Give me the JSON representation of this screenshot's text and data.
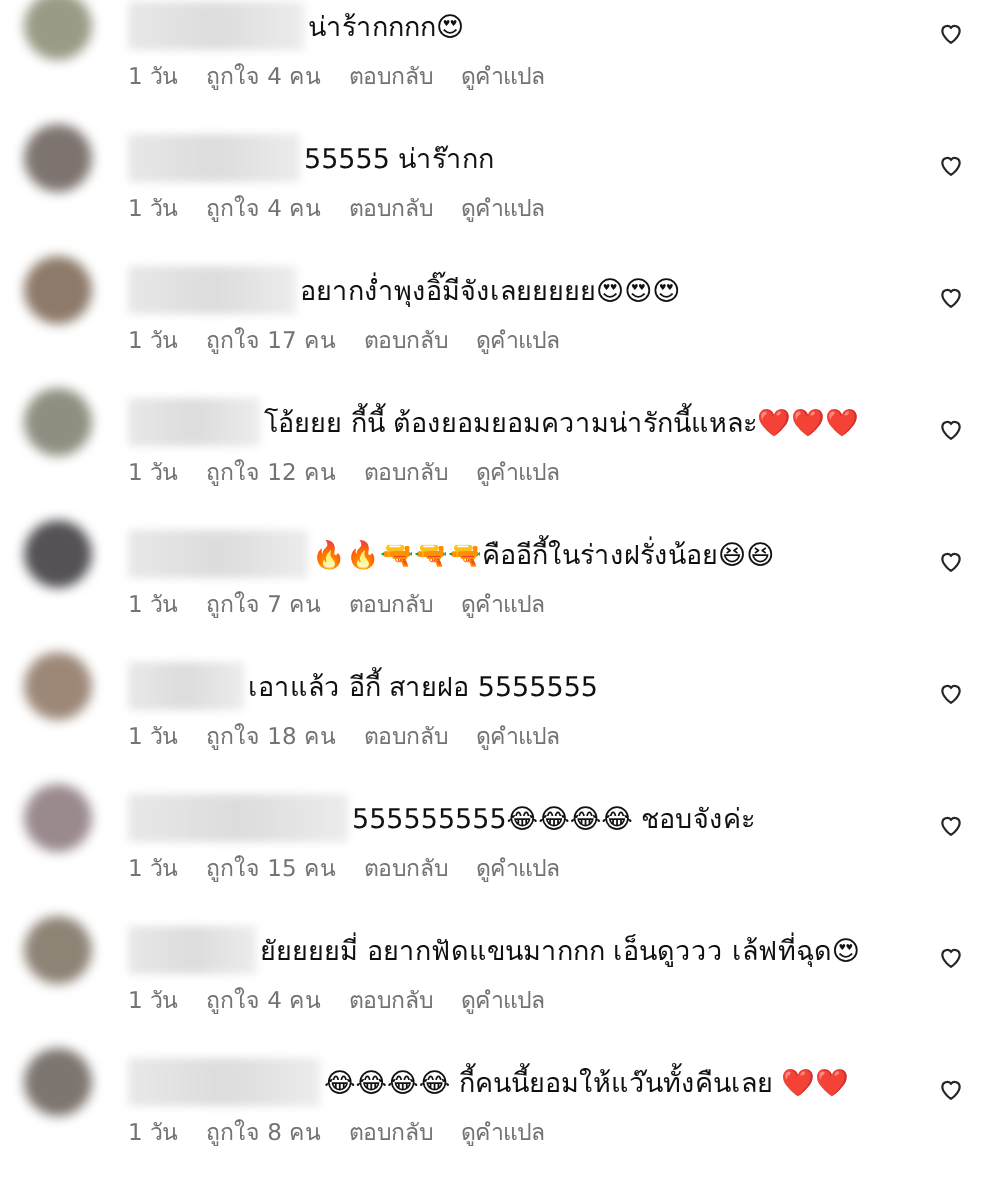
{
  "comments": [
    {
      "text": "น่าร้ากกกก😍",
      "time": "1 วัน",
      "likes": "ถูกใจ 4 คน",
      "reply": "ตอบกลับ",
      "translate": "ดูคำแปล",
      "liked": false
    },
    {
      "text": "55555 น่าร๊ากก",
      "time": "1 วัน",
      "likes": "ถูกใจ 4 คน",
      "reply": "ตอบกลับ",
      "translate": "ดูคำแปล",
      "liked": false
    },
    {
      "text": "อยากง่ำพุงอิ๊มีจังเลยยยยย😍😍😍",
      "time": "1 วัน",
      "likes": "ถูกใจ 17 คน",
      "reply": "ตอบกลับ",
      "translate": "ดูคำแปล",
      "liked": false
    },
    {
      "text": "โอ้ยยย กี้นี้ ต้องยอมยอมความน่ารักนี้แหละ❤️❤️❤️",
      "time": "1 วัน",
      "likes": "ถูกใจ 12 คน",
      "reply": "ตอบกลับ",
      "translate": "ดูคำแปล",
      "liked": false
    },
    {
      "text": "🔥🔥🔫🔫🔫คืออีกี้ในร่างฝรั่งน้อย😆😆",
      "time": "1 วัน",
      "likes": "ถูกใจ 7 คน",
      "reply": "ตอบกลับ",
      "translate": "ดูคำแปล",
      "liked": false
    },
    {
      "text": "เอาแล้ว อีกี้ สายฝอ 5555555",
      "time": "1 วัน",
      "likes": "ถูกใจ 18 คน",
      "reply": "ตอบกลับ",
      "translate": "ดูคำแปล",
      "liked": false
    },
    {
      "text": "555555555😂😂😂😂 ชอบจังค่ะ",
      "time": "1 วัน",
      "likes": "ถูกใจ 15 คน",
      "reply": "ตอบกลับ",
      "translate": "ดูคำแปล",
      "liked": false
    },
    {
      "text": "ยัยยยยมี่ อยากฟัดแขนมากกก เอ็นดูววว เล้ฟที่ฉุด😍",
      "time": "1 วัน",
      "likes": "ถูกใจ 4 คน",
      "reply": "ตอบกลับ",
      "translate": "ดูคำแปล",
      "liked": false
    },
    {
      "text": "😂😂😂😂 กี้คนนี้ยอมให้แว๊นทั้งคืนเลย ❤️❤️",
      "time": "1 วัน",
      "likes": "ถูกใจ 8 คน",
      "reply": "ตอบกลับ",
      "translate": "ดูคำแปล",
      "liked": false
    }
  ]
}
